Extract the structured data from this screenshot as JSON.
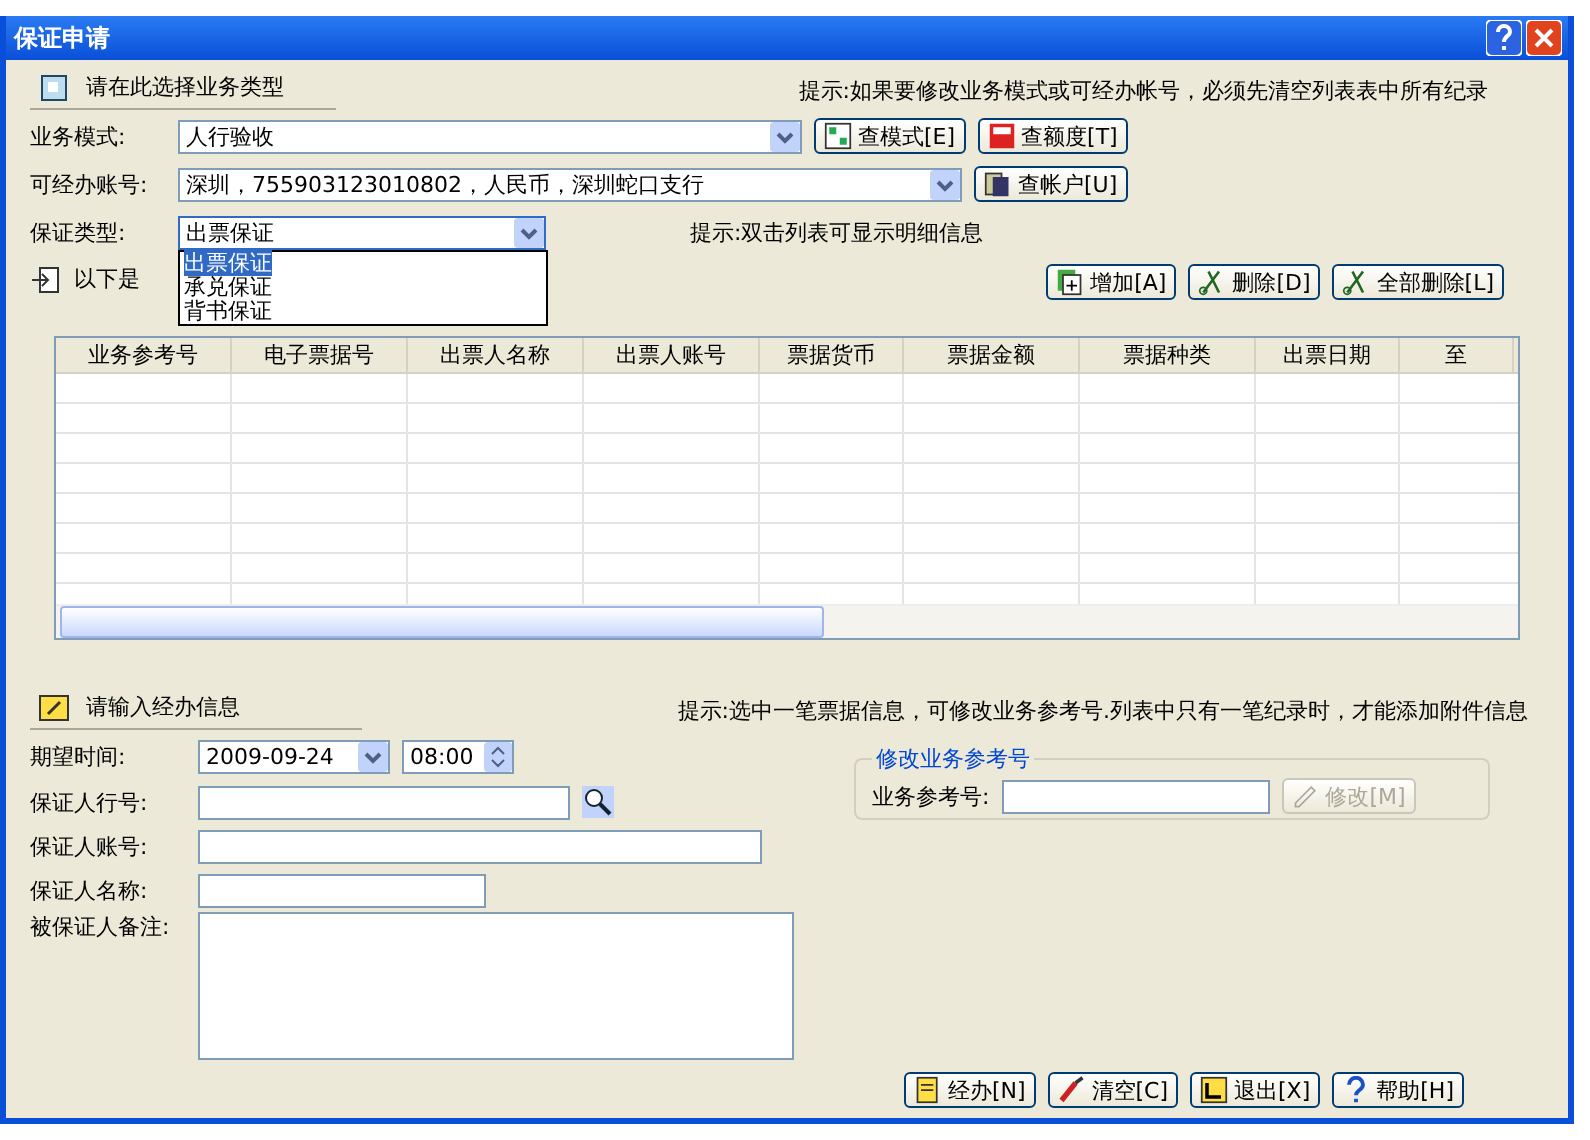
{
  "window": {
    "title": "保证申请"
  },
  "business_section": {
    "heading": "请在此选择业务类型",
    "hint": "提示:如果要修改业务模式或可经办帐号，必须先清空列表表中所有纪录"
  },
  "mode_field": {
    "label": "业务模式:",
    "value": "人行验收",
    "buttons": [
      {
        "label": "查模式[E]",
        "kind": "mode"
      },
      {
        "label": "查额度[T]",
        "kind": "quota"
      }
    ]
  },
  "account_field": {
    "label": "可经办账号:",
    "value": "深圳，755903123010802，人民币，深圳蛇口支行",
    "buttons": [
      {
        "label": "查帐户[U]",
        "kind": "account"
      }
    ]
  },
  "type_field": {
    "label": "保证类型:",
    "value": "出票保证",
    "expanded": true,
    "options": [
      {
        "label": "出票保证",
        "selected": true
      },
      {
        "label": "承兑保证",
        "selected": false
      },
      {
        "label": "背书保证",
        "selected": false
      }
    ],
    "hint": "提示:双击列表可显示明细信息"
  },
  "list_bar": {
    "label": "以下是",
    "buttons": [
      {
        "label": "增加[A]",
        "kind": "add"
      },
      {
        "label": "删除[D]",
        "kind": "delete"
      },
      {
        "label": "全部删除[L]",
        "kind": "delete"
      }
    ]
  },
  "table": {
    "columns": [
      "业务参考号",
      "电子票据号",
      "出票人名称",
      "出票人账号",
      "票据货币",
      "票据金额",
      "票据种类",
      "出票日期",
      "至"
    ]
  },
  "handling_section": {
    "heading": "请输入经办信息",
    "hint": "提示:选中一笔票据信息，可修改业务参考号.列表中只有一笔纪录时，才能添加附件信息"
  },
  "expected_time": {
    "label": "期望时间:",
    "date": "2009-09-24",
    "time": "08:00"
  },
  "form_fields": [
    {
      "label": "保证人行号:",
      "kind": "lookup"
    },
    {
      "label": "保证人账号:",
      "kind": "long"
    },
    {
      "label": "保证人名称:",
      "kind": "short"
    },
    {
      "label": "被保证人备注:",
      "kind": "memo"
    }
  ],
  "ref_group": {
    "title": "修改业务参考号",
    "label": "业务参考号:",
    "button": {
      "label": "修改[M]",
      "disabled": true
    }
  },
  "footer_buttons": [
    {
      "label": "经办[N]",
      "kind": "handle"
    },
    {
      "label": "清空[C]",
      "kind": "clear"
    },
    {
      "label": "退出[X]",
      "kind": "exit"
    },
    {
      "label": "帮助[H]",
      "kind": "help"
    }
  ]
}
